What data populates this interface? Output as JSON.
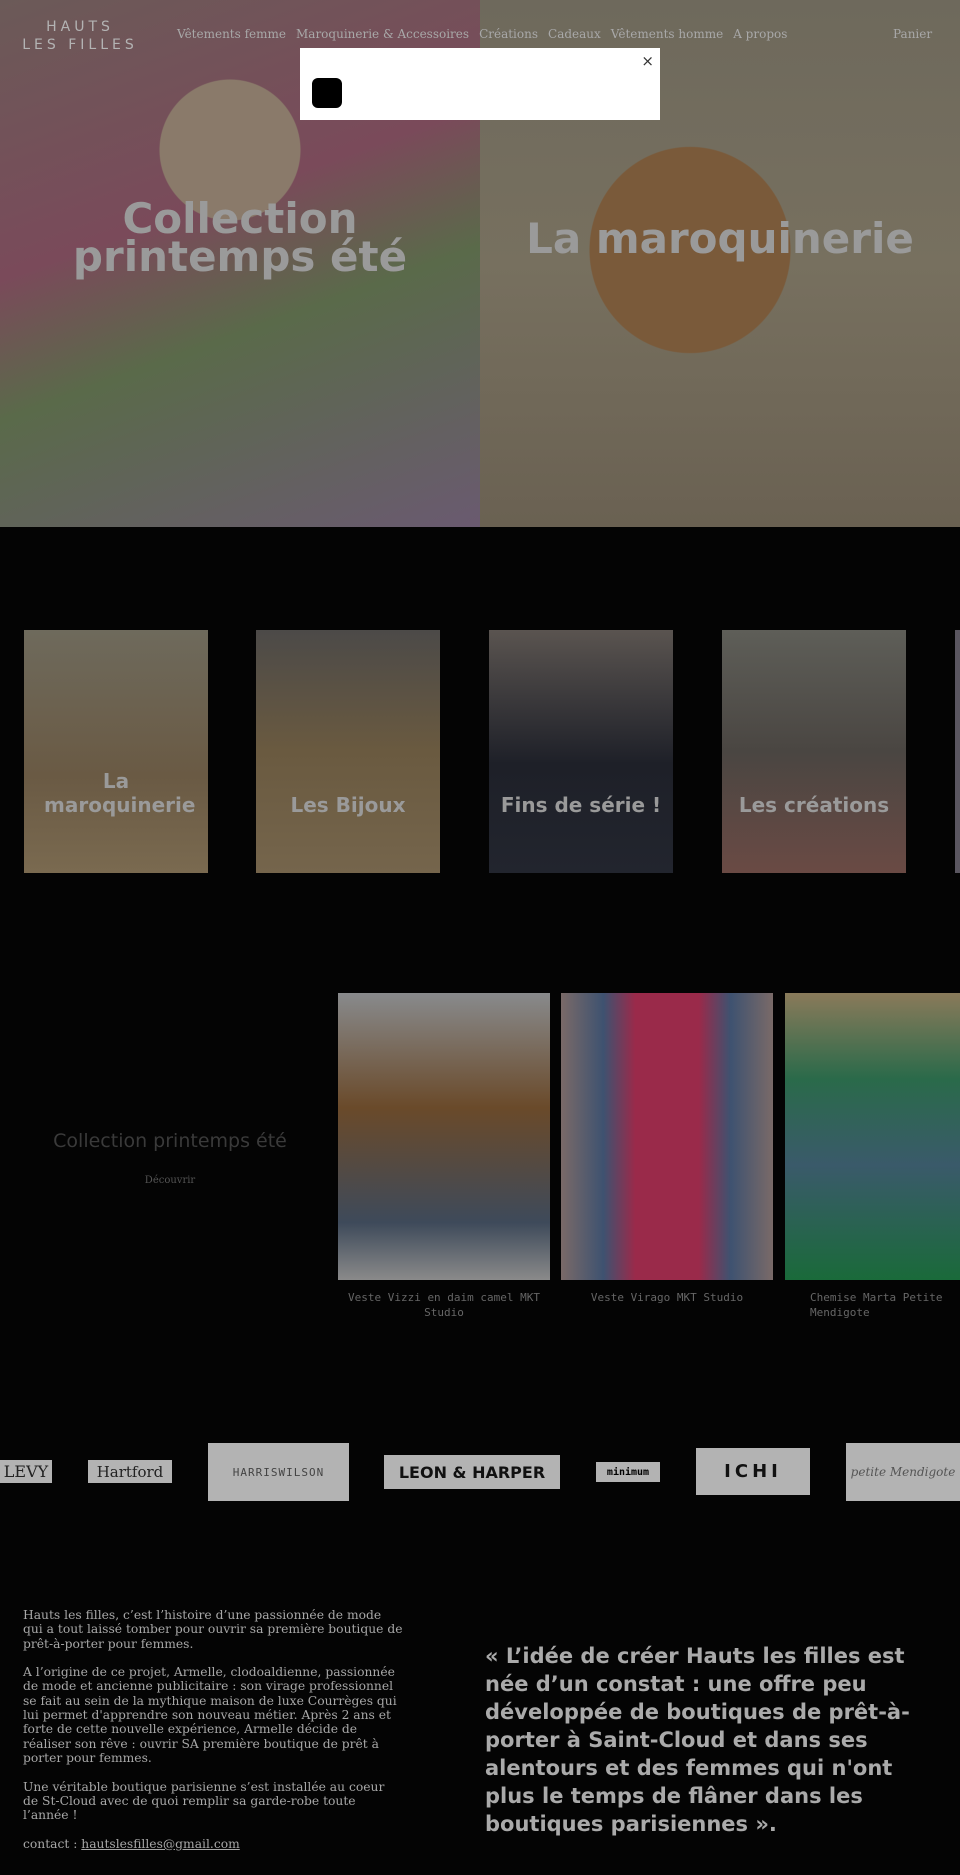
{
  "header": {
    "logo_line1": "HAUTS",
    "logo_line2": "LES FILLES",
    "nav": [
      "Vêtements femme",
      "Maroquinerie & Accessoires",
      "Créations",
      "Cadeaux",
      "Vêtements homme",
      "A propos"
    ],
    "cart": "Panier"
  },
  "popup": {
    "close": "×"
  },
  "hero": [
    {
      "title": "Collection printemps été"
    },
    {
      "title": "La maroquinerie"
    }
  ],
  "categories": [
    "La maroquinerie",
    "Les Bijoux",
    "Fins de série !",
    "Les créations"
  ],
  "collection": {
    "title": "Collection printemps été",
    "link": "Découvrir",
    "products": [
      "Veste Vizzi en daim camel MKT Studio",
      "Veste Virago MKT Studio",
      "Chemise Marta Petite Mendigote"
    ]
  },
  "brands": [
    "LEVY",
    "Hartford",
    "HARRISWILSON",
    "LEON & HARPER",
    "minimum",
    "ICHI",
    "petite Mendigote"
  ],
  "footer": {
    "p1": "Hauts les filles, c’est l’histoire d’une passionnée de mode qui a tout laissé tomber pour ouvrir sa première boutique de prêt-à-porter pour femmes.",
    "p2": "A l’origine de ce projet, Armelle, clodoaldienne, passionnée de mode et ancienne publicitaire : son virage professionnel se fait au sein de la mythique maison de luxe Courrèges qui lui permet d'apprendre son nouveau métier. Après 2 ans et forte de cette nouvelle expérience, Armelle décide de réaliser son rêve : ouvrir SA première boutique de prêt à porter pour femmes.",
    "p3": "Une véritable boutique parisienne s’est installée au coeur de St-Cloud avec de quoi remplir sa garde-robe toute l’année !",
    "contact_label": "contact : ",
    "email": "hautslesfilles@gmail.com",
    "quote": "« L’idée de créer Hauts les filles est née d’un constat : une offre peu développée de boutiques de prêt-à-porter à Saint-Cloud et dans ses alentours et des femmes qui n'ont plus le temps de flâner dans les boutiques parisiennes »."
  }
}
